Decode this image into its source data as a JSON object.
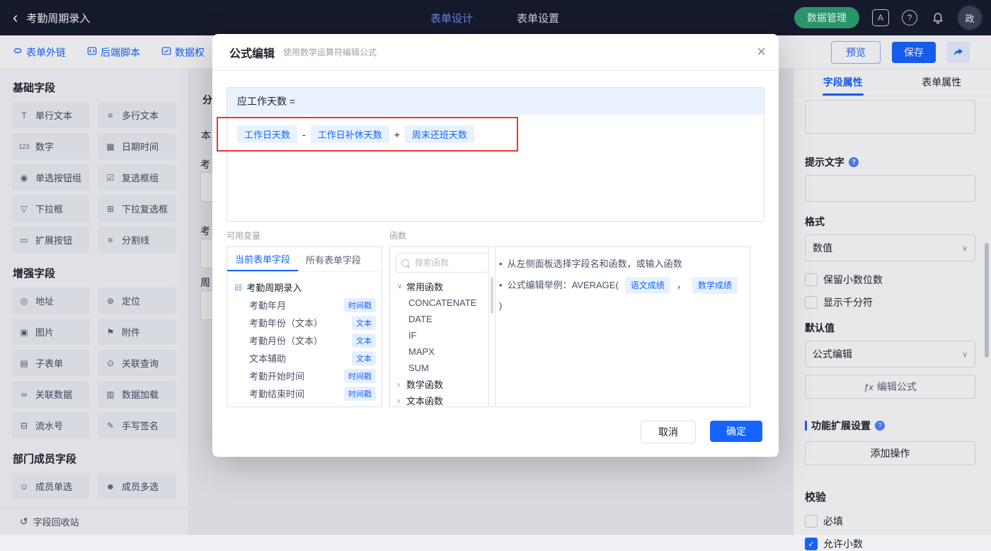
{
  "topbar": {
    "back_icon": "‹",
    "title": "考勤周期录入",
    "nav": [
      {
        "label": "表单设计"
      },
      {
        "label": "表单设置"
      }
    ],
    "data_manage_button": "数据管理",
    "avatar_text": "政"
  },
  "toolbar": {
    "links": [
      {
        "label": "表单外链"
      },
      {
        "label": "后端脚本"
      },
      {
        "label": "数据权"
      }
    ],
    "preview_button": "预览",
    "save_button": "保存"
  },
  "sidebar": {
    "sections": [
      {
        "title": "基础字段",
        "items": [
          {
            "icon": "T",
            "label": "单行文本"
          },
          {
            "icon": "≡",
            "label": "多行文本"
          },
          {
            "icon": "123",
            "label": "数字"
          },
          {
            "icon": "▦",
            "label": "日期时间"
          },
          {
            "icon": "◉",
            "label": "单选按钮组"
          },
          {
            "icon": "☑",
            "label": "复选框组"
          },
          {
            "icon": "▽",
            "label": "下拉框"
          },
          {
            "icon": "⊞",
            "label": "下拉复选框"
          },
          {
            "icon": "▭",
            "label": "扩展按钮"
          },
          {
            "icon": "≡",
            "label": "分割线"
          }
        ]
      },
      {
        "title": "增强字段",
        "items": [
          {
            "icon": "◎",
            "label": "地址"
          },
          {
            "icon": "⊕",
            "label": "定位"
          },
          {
            "icon": "▣",
            "label": "图片"
          },
          {
            "icon": "⚑",
            "label": "附件"
          },
          {
            "icon": "▤",
            "label": "子表单"
          },
          {
            "icon": "⊙",
            "label": "关联查询"
          },
          {
            "icon": "∞",
            "label": "关联数据"
          },
          {
            "icon": "▥",
            "label": "数据加载"
          },
          {
            "icon": "⊟",
            "label": "流水号"
          },
          {
            "icon": "✎",
            "label": "手写签名"
          }
        ]
      },
      {
        "title": "部门成员字段",
        "items": [
          {
            "icon": "☺",
            "label": "成员单选"
          },
          {
            "icon": "☻",
            "label": "成员多选"
          }
        ]
      }
    ],
    "recycle_icon": "↺",
    "recycle_bin": "字段回收站"
  },
  "canvas": {
    "fragments": [
      "分",
      "本",
      "考",
      "考",
      "周"
    ]
  },
  "modal": {
    "title": "公式编辑",
    "subtitle": "使用数学运算符编辑公式",
    "close_icon": "×",
    "formula_target": "应工作天数 =",
    "formula_tokens": [
      {
        "type": "field",
        "label": "工作日天数"
      },
      {
        "type": "op",
        "label": "-"
      },
      {
        "type": "field",
        "label": "工作日补休天数"
      },
      {
        "type": "op",
        "label": "+"
      },
      {
        "type": "field",
        "label": "周末还班天数"
      }
    ],
    "variables": {
      "title": "可用变量",
      "tabs": [
        {
          "label": "当前表单字段"
        },
        {
          "label": "所有表单字段"
        }
      ],
      "root": "考勤周期录入",
      "root_icon": "▤",
      "fields": [
        {
          "name": "考勤年月",
          "type": "时间戳"
        },
        {
          "name": "考勤年份（文本）",
          "type": "文本"
        },
        {
          "name": "考勤月份（文本）",
          "type": "文本"
        },
        {
          "name": "文本辅助",
          "type": "文本"
        },
        {
          "name": "考勤开始时间",
          "type": "时间戳"
        },
        {
          "name": "考勤结束时间",
          "type": "时间戳"
        }
      ]
    },
    "functions": {
      "title": "函数",
      "search_placeholder": "搜索函数",
      "groups": [
        {
          "label": "常用函数",
          "items": [
            "CONCATENATE",
            "DATE",
            "IF",
            "MAPX",
            "SUM"
          ]
        },
        {
          "label": "数学函数",
          "items": []
        },
        {
          "label": "文本函数",
          "items": []
        }
      ]
    },
    "tips": {
      "bullet": "•",
      "line1": "从左侧面板选择字段名和函数，或输入函数",
      "line2_prefix": "公式编辑举例：AVERAGE(",
      "example_field1": "语文成绩",
      "separator": "，",
      "example_field2": "数学成绩",
      "line2_suffix": ")"
    },
    "cancel_button": "取消",
    "confirm_button": "确定"
  },
  "properties": {
    "tabs": [
      {
        "label": "字段属性"
      },
      {
        "label": "表单属性"
      }
    ],
    "hint_label": "提示文字",
    "format_label": "格式",
    "format_value": "数值",
    "keep_decimals_checkbox": "保留小数位数",
    "thousands_checkbox": "显示千分符",
    "default_label": "默认值",
    "default_value": "公式编辑",
    "fx_icon": "ƒx",
    "edit_formula_button": "编辑公式",
    "extension_label": "功能扩展设置",
    "add_action_button": "添加操作",
    "validation_label": "校验",
    "required_checkbox": "必填",
    "allow_decimal_checkbox": "允许小数"
  }
}
